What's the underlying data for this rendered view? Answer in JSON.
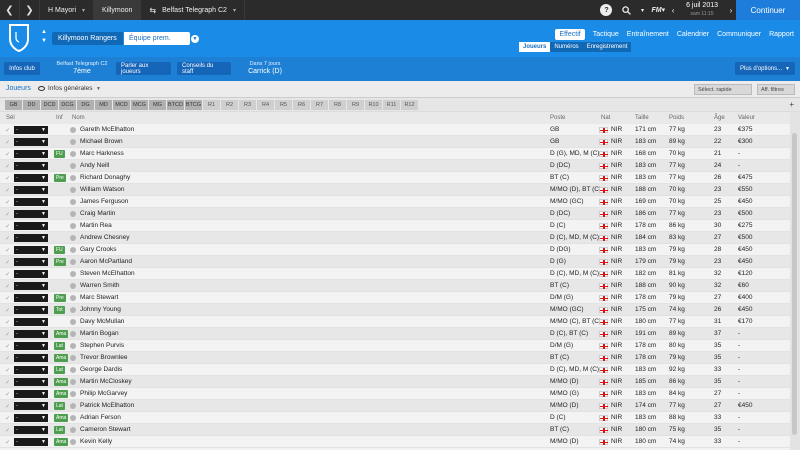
{
  "topbar": {
    "tabs": [
      {
        "label": "H Mayori",
        "active": false
      },
      {
        "label": "Killymoon",
        "active": true
      },
      {
        "label": "Belfast Telegraph C2",
        "active": false
      }
    ],
    "date_line1": "6 juil 2013",
    "date_line2": "sam 11:15",
    "fm_label": "FM",
    "continue_label": "Continuer"
  },
  "header": {
    "club_name": "Killymoon Rangers",
    "team_select": "Équipe prem.",
    "menu": [
      {
        "label": "Effectif",
        "active": true
      },
      {
        "label": "Tactique",
        "active": false
      },
      {
        "label": "Entraînement",
        "active": false
      },
      {
        "label": "Calendrier",
        "active": false
      },
      {
        "label": "Communiquer",
        "active": false
      },
      {
        "label": "Rapport",
        "active": false
      }
    ],
    "submenu": [
      {
        "label": "Joueurs",
        "active": true
      },
      {
        "label": "Numéros",
        "active": false
      },
      {
        "label": "Enregistrement",
        "active": false
      }
    ]
  },
  "infobar": {
    "infos_club": "Infos club",
    "league_name": "Belfast Telegraph C2",
    "league_pos": "7ème",
    "parler": "Parler aux joueurs",
    "conseils": "Conseils du staff",
    "next_label": "Dans 7 jours",
    "next_opp": "Carrick (D)",
    "plus_options": "Plus d'options..."
  },
  "filters": {
    "joueurs": "Joueurs",
    "view": "Infos générales",
    "select_rapide": "Sélect. rapide",
    "aff_filtres": "Aff. filtres",
    "positions": [
      "GB",
      "DD",
      "DCD",
      "DCG",
      "DG",
      "MD",
      "MCD",
      "MCG",
      "MG",
      "BTCD",
      "BTCG",
      "R1",
      "R2",
      "R3",
      "R4",
      "R5",
      "R6",
      "R7",
      "R8",
      "R9",
      "R10",
      "R11",
      "R12"
    ]
  },
  "table": {
    "headers": {
      "sel": "Sél",
      "inf": "Inf",
      "nom": "Nom",
      "poste": "Poste",
      "nat": "Nat",
      "taille": "Taille",
      "poids": "Poids",
      "age": "Âge",
      "valeur": "Valeur"
    },
    "rows": [
      {
        "inf": "",
        "name": "Gareth McElhatton",
        "poste": "GB",
        "nat": "NIR",
        "taille": "171 cm",
        "poids": "77 kg",
        "age": "23",
        "val": "€375"
      },
      {
        "inf": "",
        "name": "Michael Brown",
        "poste": "GB",
        "nat": "NIR",
        "taille": "183 cm",
        "poids": "89 kg",
        "age": "22",
        "val": "€300"
      },
      {
        "inf": "FU",
        "name": "Marc Harkness",
        "poste": "D (G), MD, M (C)",
        "nat": "NIR",
        "taille": "168 cm",
        "poids": "70 kg",
        "age": "21",
        "val": "-"
      },
      {
        "inf": "",
        "name": "Andy Neill",
        "poste": "D (DC)",
        "nat": "NIR",
        "taille": "183 cm",
        "poids": "77 kg",
        "age": "24",
        "val": "-"
      },
      {
        "inf": "Pre",
        "name": "Richard Donaghy",
        "poste": "BT (C)",
        "nat": "NIR",
        "taille": "183 cm",
        "poids": "77 kg",
        "age": "26",
        "val": "€475"
      },
      {
        "inf": "",
        "name": "William Watson",
        "poste": "M/MO (D), BT (C)",
        "nat": "NIR",
        "taille": "188 cm",
        "poids": "70 kg",
        "age": "23",
        "val": "€550"
      },
      {
        "inf": "",
        "name": "James Ferguson",
        "poste": "M/MO (GC)",
        "nat": "NIR",
        "taille": "169 cm",
        "poids": "70 kg",
        "age": "25",
        "val": "€450"
      },
      {
        "inf": "",
        "name": "Craig Martin",
        "poste": "D (DC)",
        "nat": "NIR",
        "taille": "186 cm",
        "poids": "77 kg",
        "age": "23",
        "val": "€500"
      },
      {
        "inf": "",
        "name": "Martin Rea",
        "poste": "D (C)",
        "nat": "NIR",
        "taille": "178 cm",
        "poids": "86 kg",
        "age": "30",
        "val": "€275"
      },
      {
        "inf": "",
        "name": "Andrew Chesney",
        "poste": "D (C), MD, M (C)",
        "nat": "NIR",
        "taille": "184 cm",
        "poids": "83 kg",
        "age": "27",
        "val": "€500"
      },
      {
        "inf": "FU",
        "name": "Gary Crooks",
        "poste": "D (DG)",
        "nat": "NIR",
        "taille": "183 cm",
        "poids": "79 kg",
        "age": "28",
        "val": "€450"
      },
      {
        "inf": "Pre",
        "name": "Aaron McPartland",
        "poste": "D (G)",
        "nat": "NIR",
        "taille": "179 cm",
        "poids": "79 kg",
        "age": "23",
        "val": "€450"
      },
      {
        "inf": "",
        "name": "Steven McElhatton",
        "poste": "D (C), MD, M (C)",
        "nat": "NIR",
        "taille": "182 cm",
        "poids": "81 kg",
        "age": "32",
        "val": "€120"
      },
      {
        "inf": "",
        "name": "Warren Smith",
        "poste": "BT (C)",
        "nat": "NIR",
        "taille": "188 cm",
        "poids": "90 kg",
        "age": "32",
        "val": "€60"
      },
      {
        "inf": "Pre",
        "name": "Marc Stewart",
        "poste": "D/M (G)",
        "nat": "NIR",
        "taille": "178 cm",
        "poids": "79 kg",
        "age": "27",
        "val": "€400"
      },
      {
        "inf": "Tot",
        "name": "Johnny Young",
        "poste": "M/MO (GC)",
        "nat": "NIR",
        "taille": "175 cm",
        "poids": "74 kg",
        "age": "26",
        "val": "€450"
      },
      {
        "inf": "",
        "name": "Davy McMullan",
        "poste": "M/MO (C), BT (C)",
        "nat": "NIR",
        "taille": "180 cm",
        "poids": "77 kg",
        "age": "31",
        "val": "€170"
      },
      {
        "inf": "Ama",
        "name": "Martin Bogan",
        "poste": "D (C), BT (C)",
        "nat": "NIR",
        "taille": "191 cm",
        "poids": "89 kg",
        "age": "37",
        "val": "-"
      },
      {
        "inf": "Lat",
        "name": "Stephen Purvis",
        "poste": "D/M (G)",
        "nat": "NIR",
        "taille": "178 cm",
        "poids": "80 kg",
        "age": "35",
        "val": "-"
      },
      {
        "inf": "Ama",
        "name": "Trevor Brownlee",
        "poste": "BT (C)",
        "nat": "NIR",
        "taille": "178 cm",
        "poids": "79 kg",
        "age": "35",
        "val": "-"
      },
      {
        "inf": "Lat",
        "name": "George Dardis",
        "poste": "D (C), MD, M (C)",
        "nat": "NIR",
        "taille": "183 cm",
        "poids": "92 kg",
        "age": "33",
        "val": "-"
      },
      {
        "inf": "Ama",
        "name": "Martin McCloskey",
        "poste": "M/MO (D)",
        "nat": "NIR",
        "taille": "185 cm",
        "poids": "86 kg",
        "age": "35",
        "val": "-"
      },
      {
        "inf": "Ama",
        "name": "Philip McGarvey",
        "poste": "M/MO (G)",
        "nat": "NIR",
        "taille": "183 cm",
        "poids": "84 kg",
        "age": "27",
        "val": "-"
      },
      {
        "inf": "Lat",
        "name": "Patrick McElhatton",
        "poste": "M/MO (D)",
        "nat": "NIR",
        "taille": "174 cm",
        "poids": "77 kg",
        "age": "27",
        "val": "€450"
      },
      {
        "inf": "Ama",
        "name": "Adrian Ferson",
        "poste": "D (C)",
        "nat": "NIR",
        "taille": "183 cm",
        "poids": "88 kg",
        "age": "33",
        "val": "-"
      },
      {
        "inf": "Lat",
        "name": "Cameron Stewart",
        "poste": "BT (C)",
        "nat": "NIR",
        "taille": "180 cm",
        "poids": "75 kg",
        "age": "35",
        "val": "-"
      },
      {
        "inf": "Ama",
        "name": "Kevin Kelly",
        "poste": "M/MO (D)",
        "nat": "NIR",
        "taille": "180 cm",
        "poids": "74 kg",
        "age": "33",
        "val": "-"
      }
    ]
  },
  "colors": {
    "accent": "#1a8ce8",
    "dark": "#2b2b2b",
    "continue": "#1e7ddb",
    "badge": "#4f9e4f"
  }
}
